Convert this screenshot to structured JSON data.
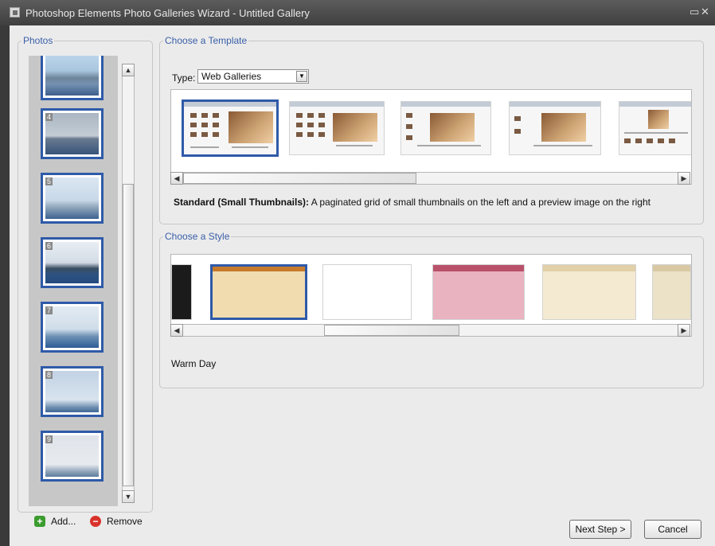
{
  "window": {
    "title": "Photoshop Elements Photo Galleries Wizard - Untitled Gallery",
    "restore_glyph": "▭",
    "close_glyph": "✕"
  },
  "photos": {
    "legend": "Photos",
    "thumbnails": [
      {
        "number": "",
        "image": "city"
      },
      {
        "number": "4",
        "image": "cloudy"
      },
      {
        "number": "5",
        "image": "sail"
      },
      {
        "number": "6",
        "image": "island"
      },
      {
        "number": "7",
        "image": "sea"
      },
      {
        "number": "8",
        "image": "sky"
      },
      {
        "number": "9",
        "image": "haze"
      }
    ],
    "add_label": "Add...",
    "remove_label": "Remove"
  },
  "template": {
    "legend": "Choose a Template",
    "type_label": "Type:",
    "type_value": "Web Galleries",
    "selected_name": "Standard (Small Thumbnails):",
    "selected_description": "A paginated grid of small thumbnails on the left and a preview image on the right"
  },
  "style": {
    "legend": "Choose a Style",
    "selected_name": "Warm Day",
    "styles": [
      {
        "header": "#222222",
        "body": "#111111"
      },
      {
        "header": "#c77b2a",
        "body": "#f1dcb0"
      },
      {
        "header": "#f2f2f2",
        "body": "#ffffff"
      },
      {
        "header": "#b9516a",
        "body": "#eab3c0"
      },
      {
        "header": "#e2d0a8",
        "body": "#f4ead2"
      },
      {
        "header": "#d8c9a4",
        "body": "#ece2c8"
      }
    ]
  },
  "buttons": {
    "next": "Next Step >",
    "cancel": "Cancel"
  },
  "colors": {
    "accent": "#2e5aa8",
    "legend": "#3a5fa8"
  }
}
